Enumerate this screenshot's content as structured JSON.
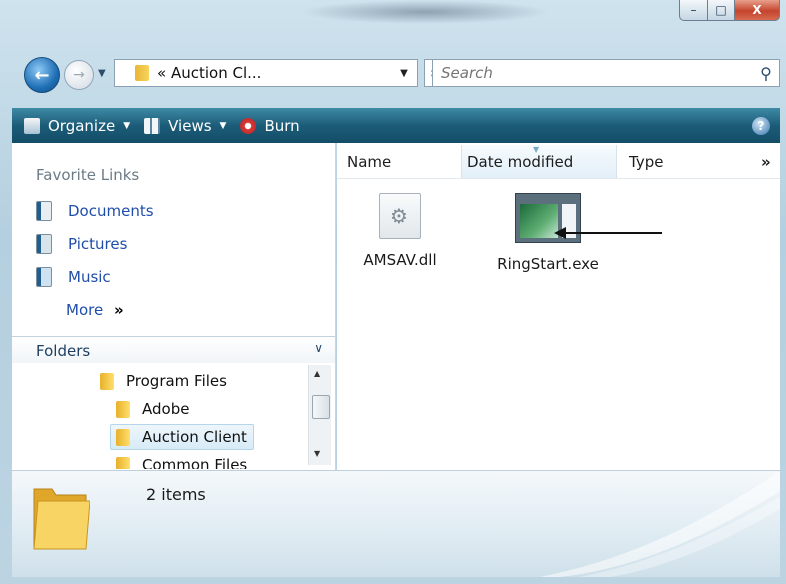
{
  "window": {
    "caption_min": "–",
    "caption_max": "□",
    "caption_close": "X"
  },
  "address_bar": {
    "back_icon": "back-arrow",
    "forward_icon": "forward-arrow",
    "prefix": "«",
    "path": "Auction Cl...",
    "refresh_icon": "refresh"
  },
  "search": {
    "placeholder": "Search",
    "icon": "magnifier"
  },
  "toolbar": {
    "organize": "Organize",
    "views": "Views",
    "burn": "Burn",
    "help": "?"
  },
  "favorite_links": {
    "title": "Favorite Links",
    "items": [
      {
        "label": "Documents",
        "icon": "documents-icon"
      },
      {
        "label": "Pictures",
        "icon": "pictures-icon"
      },
      {
        "label": "Music",
        "icon": "music-icon"
      }
    ],
    "more": "More",
    "more_arrow": "»"
  },
  "folders": {
    "label": "Folders",
    "chevron": "∨",
    "items": [
      {
        "label": "Program Files",
        "selected": false
      },
      {
        "label": "Adobe",
        "selected": false
      },
      {
        "label": "Auction Client",
        "selected": true
      },
      {
        "label": "Common Files",
        "selected": false
      }
    ]
  },
  "columns": {
    "name": "Name",
    "date": "Date modified",
    "type": "Type",
    "more": "»"
  },
  "files": [
    {
      "name": "AMSAV.dll",
      "icon": "dll-file-icon"
    },
    {
      "name": "RingStart.exe",
      "icon": "exe-file-icon"
    }
  ],
  "details": {
    "count": "2 items"
  },
  "colors": {
    "toolbar": "#1c5c78",
    "link": "#1f4eaa",
    "close": "#c4442d"
  }
}
